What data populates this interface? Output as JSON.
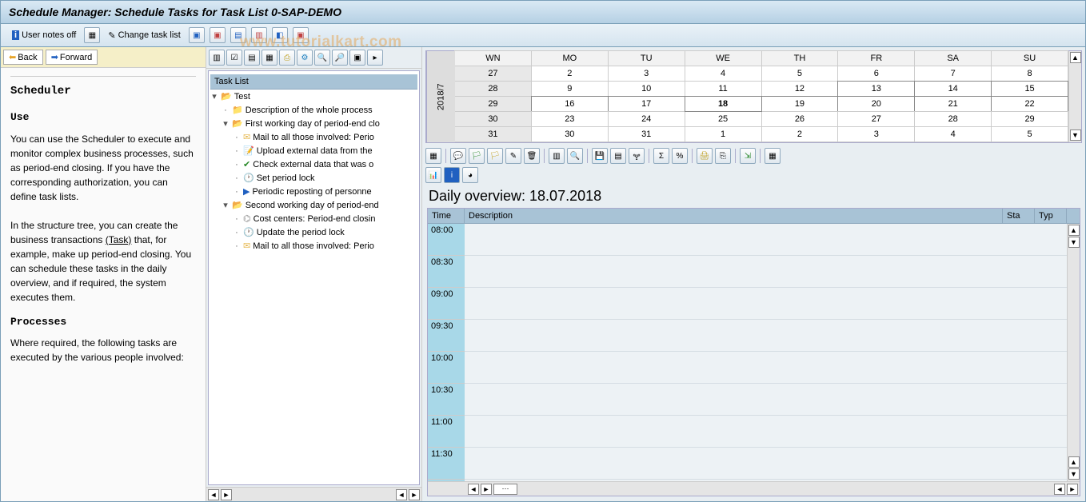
{
  "title": "Schedule Manager: Schedule Tasks for Task List 0-SAP-DEMO",
  "main_toolbar": {
    "user_notes": "User notes off",
    "change_task": "Change task list"
  },
  "watermark": "www.tutorialkart.com",
  "nav": {
    "back": "Back",
    "forward": "Forward"
  },
  "help": {
    "title": "Scheduler",
    "use_h": "Use",
    "use_p1": "You can use the Scheduler to execute and monitor complex business processes, such as period-end closing. If you have the corresponding authorization, you can define task lists.",
    "use_p2a": "In the structure tree, you can create the business transactions ",
    "use_p2_link": "(Task)",
    "use_p2b": " that, for example, make up period-end closing. You can schedule these tasks in the daily overview, and if required, the system executes them.",
    "proc_h": "Processes",
    "proc_p": "Where required, the following tasks are executed by the various people involved:"
  },
  "tree": {
    "header": "Task List",
    "root": "Test",
    "items": [
      "Description of the whole process",
      "First working day of period-end clo",
      "Mail to all those involved: Perio",
      "Upload external data from the",
      "Check external data that was o",
      "Set period lock",
      "Periodic reposting of personne",
      "Second working day of period-end",
      "Cost centers: Period-end closin",
      "Update the period lock",
      "Mail to all those involved: Perio"
    ]
  },
  "calendar": {
    "period": "2018/7",
    "days": [
      "WN",
      "MO",
      "TU",
      "WE",
      "TH",
      "FR",
      "SA",
      "SU"
    ],
    "rows": [
      {
        "wn": "27",
        "d": [
          "2",
          "3",
          "4",
          "5",
          "6",
          "7",
          "8"
        ]
      },
      {
        "wn": "28",
        "d": [
          "9",
          "10",
          "11",
          "12",
          "13",
          "14",
          "15"
        ]
      },
      {
        "wn": "29",
        "d": [
          "16",
          "17",
          "18",
          "19",
          "20",
          "21",
          "22"
        ]
      },
      {
        "wn": "30",
        "d": [
          "23",
          "24",
          "25",
          "26",
          "27",
          "28",
          "29"
        ]
      },
      {
        "wn": "31",
        "d": [
          "30",
          "31",
          "1",
          "2",
          "3",
          "4",
          "5"
        ]
      }
    ],
    "boxed_row": 1,
    "boxed_row2": 2,
    "today": "18"
  },
  "daily": {
    "title": "Daily overview: 18.07.2018",
    "cols": {
      "time": "Time",
      "desc": "Description",
      "sta": "Sta",
      "typ": "Typ"
    },
    "times": [
      "08:00",
      "08:30",
      "09:00",
      "09:30",
      "10:00",
      "10:30",
      "11:00",
      "11:30"
    ]
  }
}
